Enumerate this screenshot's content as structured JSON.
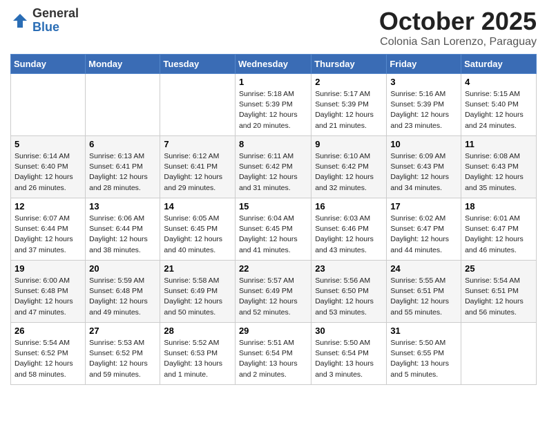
{
  "logo": {
    "general": "General",
    "blue": "Blue"
  },
  "header": {
    "month": "October 2025",
    "location": "Colonia San Lorenzo, Paraguay"
  },
  "weekdays": [
    "Sunday",
    "Monday",
    "Tuesday",
    "Wednesday",
    "Thursday",
    "Friday",
    "Saturday"
  ],
  "weeks": [
    [
      {
        "day": "",
        "info": ""
      },
      {
        "day": "",
        "info": ""
      },
      {
        "day": "",
        "info": ""
      },
      {
        "day": "1",
        "info": "Sunrise: 5:18 AM\nSunset: 5:39 PM\nDaylight: 12 hours\nand 20 minutes."
      },
      {
        "day": "2",
        "info": "Sunrise: 5:17 AM\nSunset: 5:39 PM\nDaylight: 12 hours\nand 21 minutes."
      },
      {
        "day": "3",
        "info": "Sunrise: 5:16 AM\nSunset: 5:39 PM\nDaylight: 12 hours\nand 23 minutes."
      },
      {
        "day": "4",
        "info": "Sunrise: 5:15 AM\nSunset: 5:40 PM\nDaylight: 12 hours\nand 24 minutes."
      }
    ],
    [
      {
        "day": "5",
        "info": "Sunrise: 6:14 AM\nSunset: 6:40 PM\nDaylight: 12 hours\nand 26 minutes."
      },
      {
        "day": "6",
        "info": "Sunrise: 6:13 AM\nSunset: 6:41 PM\nDaylight: 12 hours\nand 28 minutes."
      },
      {
        "day": "7",
        "info": "Sunrise: 6:12 AM\nSunset: 6:41 PM\nDaylight: 12 hours\nand 29 minutes."
      },
      {
        "day": "8",
        "info": "Sunrise: 6:11 AM\nSunset: 6:42 PM\nDaylight: 12 hours\nand 31 minutes."
      },
      {
        "day": "9",
        "info": "Sunrise: 6:10 AM\nSunset: 6:42 PM\nDaylight: 12 hours\nand 32 minutes."
      },
      {
        "day": "10",
        "info": "Sunrise: 6:09 AM\nSunset: 6:43 PM\nDaylight: 12 hours\nand 34 minutes."
      },
      {
        "day": "11",
        "info": "Sunrise: 6:08 AM\nSunset: 6:43 PM\nDaylight: 12 hours\nand 35 minutes."
      }
    ],
    [
      {
        "day": "12",
        "info": "Sunrise: 6:07 AM\nSunset: 6:44 PM\nDaylight: 12 hours\nand 37 minutes."
      },
      {
        "day": "13",
        "info": "Sunrise: 6:06 AM\nSunset: 6:44 PM\nDaylight: 12 hours\nand 38 minutes."
      },
      {
        "day": "14",
        "info": "Sunrise: 6:05 AM\nSunset: 6:45 PM\nDaylight: 12 hours\nand 40 minutes."
      },
      {
        "day": "15",
        "info": "Sunrise: 6:04 AM\nSunset: 6:45 PM\nDaylight: 12 hours\nand 41 minutes."
      },
      {
        "day": "16",
        "info": "Sunrise: 6:03 AM\nSunset: 6:46 PM\nDaylight: 12 hours\nand 43 minutes."
      },
      {
        "day": "17",
        "info": "Sunrise: 6:02 AM\nSunset: 6:47 PM\nDaylight: 12 hours\nand 44 minutes."
      },
      {
        "day": "18",
        "info": "Sunrise: 6:01 AM\nSunset: 6:47 PM\nDaylight: 12 hours\nand 46 minutes."
      }
    ],
    [
      {
        "day": "19",
        "info": "Sunrise: 6:00 AM\nSunset: 6:48 PM\nDaylight: 12 hours\nand 47 minutes."
      },
      {
        "day": "20",
        "info": "Sunrise: 5:59 AM\nSunset: 6:48 PM\nDaylight: 12 hours\nand 49 minutes."
      },
      {
        "day": "21",
        "info": "Sunrise: 5:58 AM\nSunset: 6:49 PM\nDaylight: 12 hours\nand 50 minutes."
      },
      {
        "day": "22",
        "info": "Sunrise: 5:57 AM\nSunset: 6:49 PM\nDaylight: 12 hours\nand 52 minutes."
      },
      {
        "day": "23",
        "info": "Sunrise: 5:56 AM\nSunset: 6:50 PM\nDaylight: 12 hours\nand 53 minutes."
      },
      {
        "day": "24",
        "info": "Sunrise: 5:55 AM\nSunset: 6:51 PM\nDaylight: 12 hours\nand 55 minutes."
      },
      {
        "day": "25",
        "info": "Sunrise: 5:54 AM\nSunset: 6:51 PM\nDaylight: 12 hours\nand 56 minutes."
      }
    ],
    [
      {
        "day": "26",
        "info": "Sunrise: 5:54 AM\nSunset: 6:52 PM\nDaylight: 12 hours\nand 58 minutes."
      },
      {
        "day": "27",
        "info": "Sunrise: 5:53 AM\nSunset: 6:52 PM\nDaylight: 12 hours\nand 59 minutes."
      },
      {
        "day": "28",
        "info": "Sunrise: 5:52 AM\nSunset: 6:53 PM\nDaylight: 13 hours\nand 1 minute."
      },
      {
        "day": "29",
        "info": "Sunrise: 5:51 AM\nSunset: 6:54 PM\nDaylight: 13 hours\nand 2 minutes."
      },
      {
        "day": "30",
        "info": "Sunrise: 5:50 AM\nSunset: 6:54 PM\nDaylight: 13 hours\nand 3 minutes."
      },
      {
        "day": "31",
        "info": "Sunrise: 5:50 AM\nSunset: 6:55 PM\nDaylight: 13 hours\nand 5 minutes."
      },
      {
        "day": "",
        "info": ""
      }
    ]
  ]
}
